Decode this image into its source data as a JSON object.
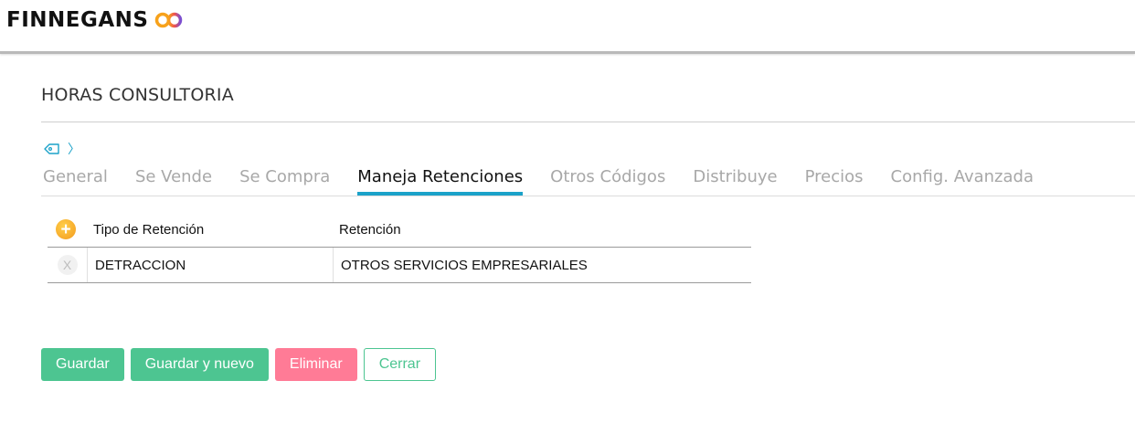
{
  "header": {
    "brand": "FINNEGANS",
    "logo_icon": "infinity-logo-icon"
  },
  "page": {
    "title": "HORAS CONSULTORIA"
  },
  "breadcrumb": {
    "tag_icon": "tag-icon",
    "chevron": "〉"
  },
  "tabs": [
    {
      "label": "General",
      "active": false
    },
    {
      "label": "Se Vende",
      "active": false
    },
    {
      "label": "Se Compra",
      "active": false
    },
    {
      "label": "Maneja Retenciones",
      "active": true
    },
    {
      "label": "Otros Códigos",
      "active": false
    },
    {
      "label": "Distribuye",
      "active": false
    },
    {
      "label": "Precios",
      "active": false
    },
    {
      "label": "Config. Avanzada",
      "active": false
    }
  ],
  "grid": {
    "add_symbol": "+",
    "columns": [
      "Tipo de Retención",
      "Retención"
    ],
    "rows": [
      {
        "delete_symbol": "X",
        "tipo": "DETRACCION",
        "retencion": "OTROS SERVICIOS EMPRESARIALES"
      }
    ]
  },
  "actions": {
    "save": "Guardar",
    "save_new": "Guardar y nuevo",
    "delete": "Eliminar",
    "close": "Cerrar"
  },
  "colors": {
    "accent_tab": "#1ba2c9",
    "primary_button": "#4dc591",
    "danger_button": "#ff7b96"
  }
}
